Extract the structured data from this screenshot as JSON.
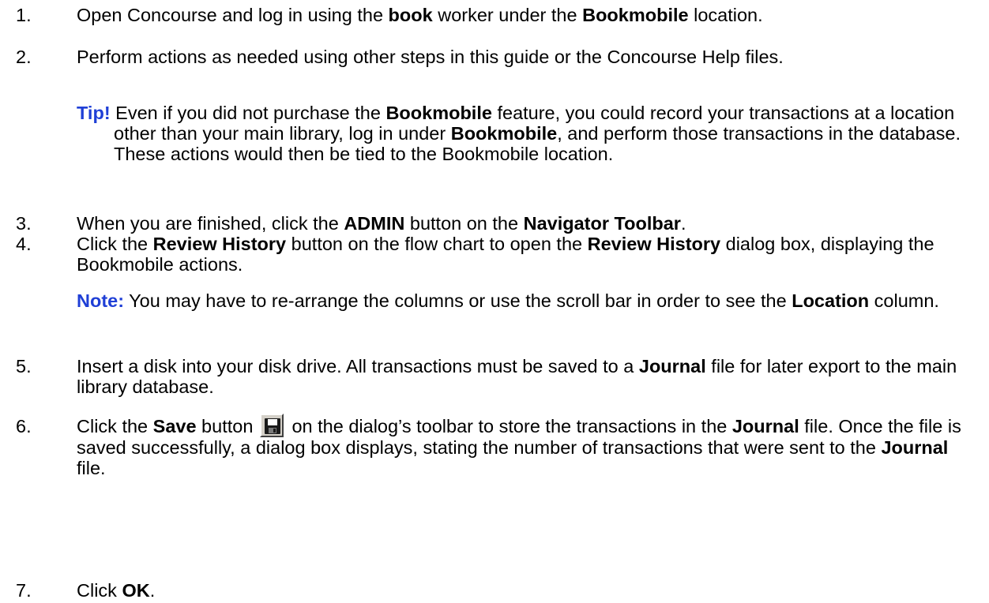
{
  "steps": [
    {
      "num": "1.",
      "parts": [
        "Open Concourse and log in using the ",
        "book",
        " worker under the ",
        "Bookmobile",
        " location."
      ]
    },
    {
      "num": "2.",
      "text": "Perform actions as needed using other steps in this guide or the Concourse Help files."
    },
    {
      "num": "3.",
      "parts": [
        "When you are finished, click the ",
        "ADMIN",
        " button on the ",
        "Navigator Toolbar",
        "."
      ]
    },
    {
      "num": "4.",
      "parts": [
        "Click the ",
        "Review History",
        " button on the flow chart to open the ",
        "Review History",
        " dialog box, displaying the Bookmobile actions."
      ]
    },
    {
      "num": "5.",
      "parts": [
        "Insert a disk into your disk drive. All transactions must be saved to a ",
        "Journal",
        " file for later export to the main library database."
      ]
    },
    {
      "num": "6.",
      "parts": [
        "Click the ",
        "Save",
        " button ",
        " on the dialog’s toolbar to store the transactions in the ",
        "Journal",
        " file. Once the file is saved successfully, a dialog box displays, stating the number of transactions that were sent to the ",
        "Journal",
        " file."
      ],
      "icon": "floppy-disk-save-icon"
    },
    {
      "num": "7.",
      "parts": [
        "Click ",
        "OK",
        "."
      ]
    }
  ],
  "tip": {
    "label": "Tip!",
    "parts": [
      " Even if you did not purchase the ",
      "Bookmobile",
      " feature, you could record your transactions at a location other than your main library, log in under ",
      "Bookmobile",
      ", and perform those transactions in the database. These actions would then be tied to the Bookmobile location."
    ]
  },
  "note": {
    "label": "Note:",
    "parts": [
      " You may have to re-arrange the columns or use the scroll bar in order to see the ",
      "Location",
      " column."
    ]
  },
  "colors": {
    "callout_label": "#1f3fd6",
    "text": "#000000"
  }
}
